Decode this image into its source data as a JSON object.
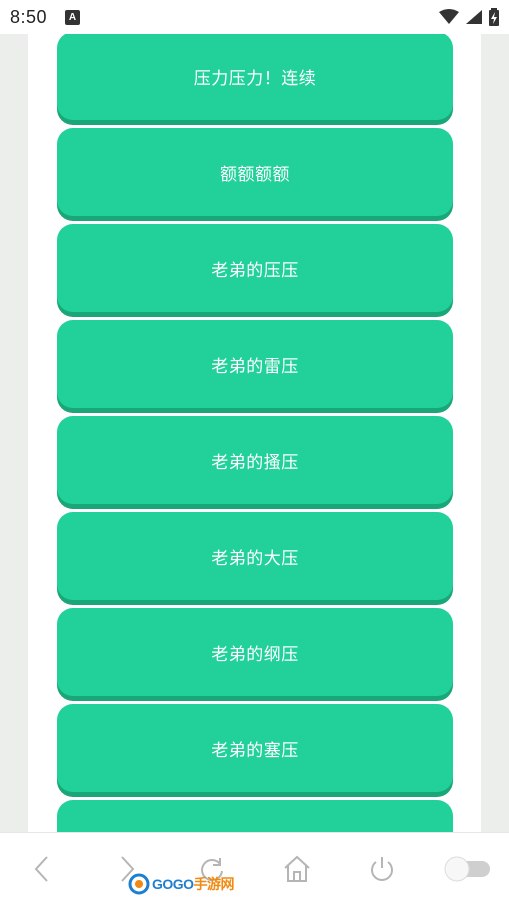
{
  "status_bar": {
    "time": "8:50",
    "app_icon_letter": "A"
  },
  "buttons": [
    {
      "label": "压力压力！连续"
    },
    {
      "label": "额额额额"
    },
    {
      "label": "老弟的压压"
    },
    {
      "label": "老弟的雷压"
    },
    {
      "label": "老弟的搔压"
    },
    {
      "label": "老弟的大压"
    },
    {
      "label": "老弟的纲压"
    },
    {
      "label": "老弟的塞压"
    },
    {
      "label": ""
    }
  ],
  "nav": {
    "icons": [
      "back-icon",
      "forward-icon",
      "refresh-icon",
      "home-icon",
      "power-icon",
      "toggle-switch"
    ]
  },
  "watermark": {
    "text_latin": "GOGO",
    "text_cn": "手游网"
  },
  "colors": {
    "button": "#22d199",
    "button_shadow": "#1aa777",
    "page_bg": "#eceeec"
  }
}
